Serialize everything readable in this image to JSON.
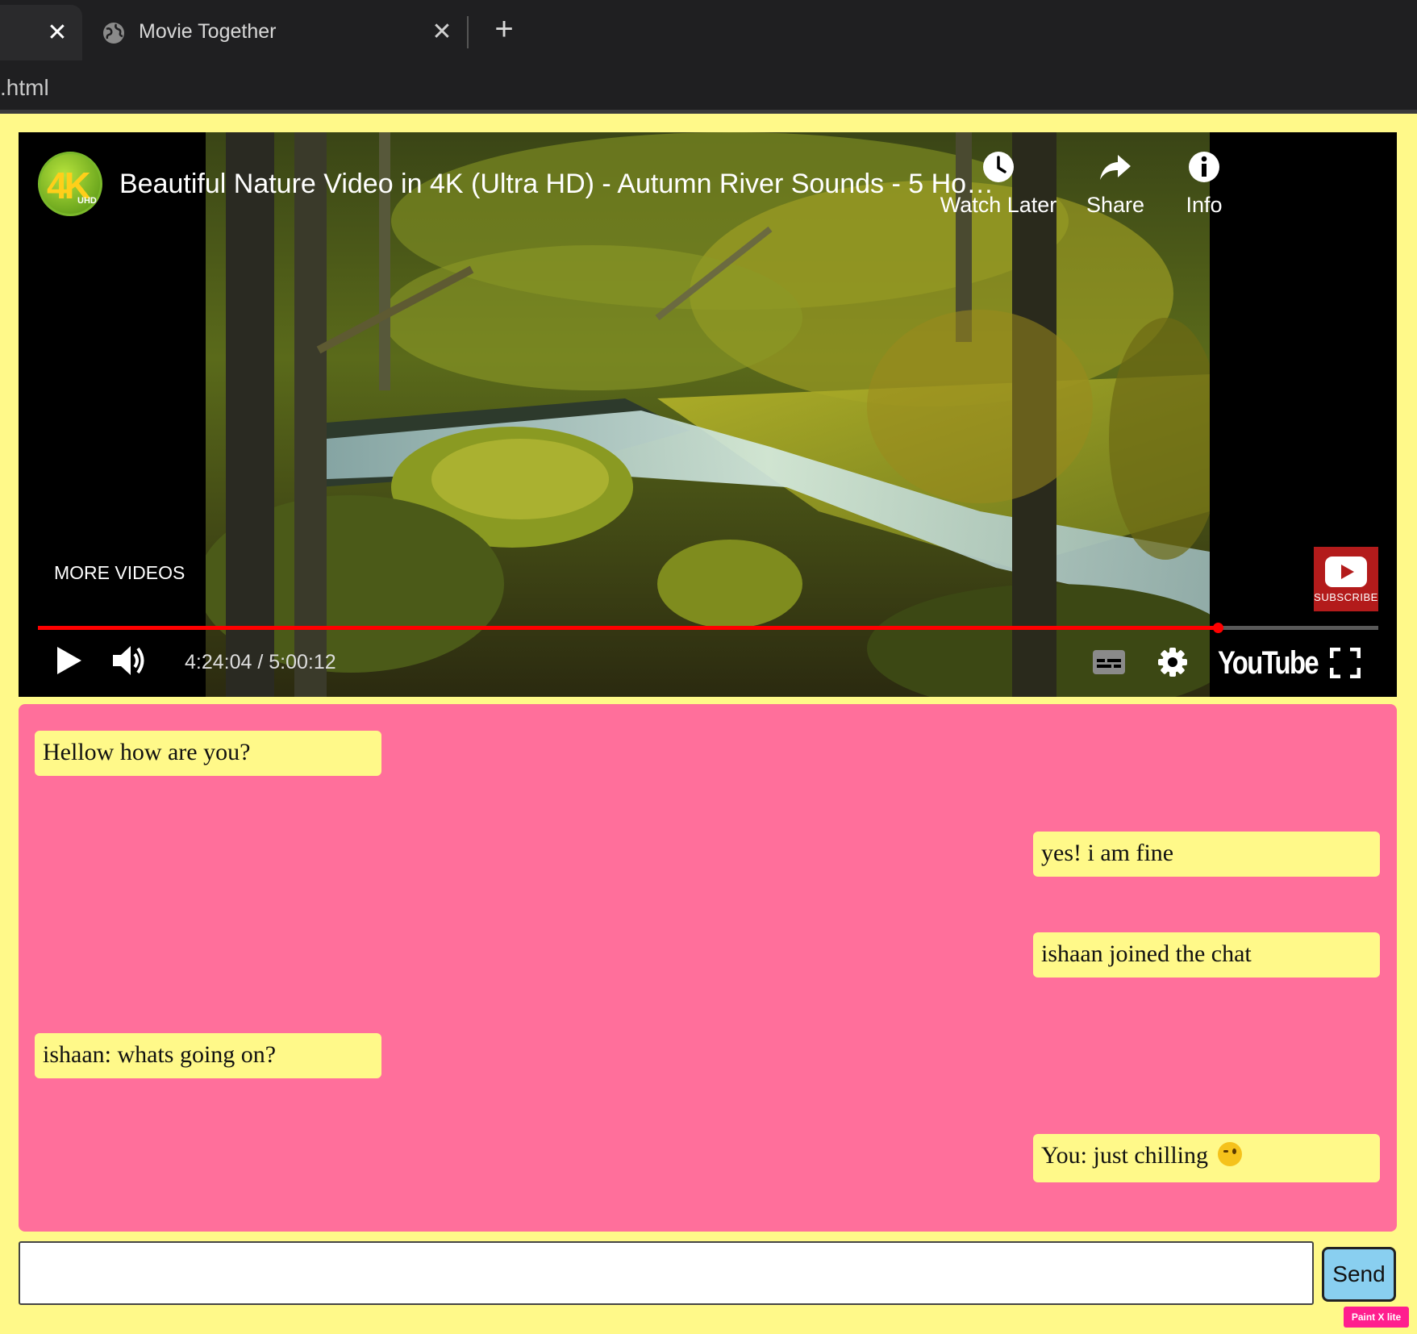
{
  "browser": {
    "active_tab_title": "Movie Together",
    "address_text": ".html"
  },
  "player": {
    "video_title": "Beautiful Nature Video in 4K (Ultra HD) - Autumn River Sounds - 5 Ho…",
    "channel_logo_text": "4K",
    "channel_logo_subtext": "UHD",
    "watch_later_label": "Watch Later",
    "share_label": "Share",
    "info_label": "Info",
    "more_videos_label": "MORE VIDEOS",
    "subscribe_label": "SUBSCRIBE",
    "current_time": "4:24:04",
    "duration": "5:00:12",
    "time_display": "4:24:04 / 5:00:12",
    "progress_fraction": 0.88,
    "youtube_label": "YouTube",
    "accent_color": "#ff0000",
    "icons": [
      "play-icon",
      "volume-icon",
      "captions-icon",
      "settings-icon",
      "fullscreen-icon",
      "clock-icon",
      "share-arrow-icon",
      "info-icon"
    ]
  },
  "chat": {
    "background_color": "#ff6f9b",
    "bubble_color": "#fff989",
    "messages": [
      {
        "text": "Hellow how are you?",
        "side": "left"
      },
      {
        "text": "yes! i am fine",
        "side": "right"
      },
      {
        "text": "ishaan joined the chat",
        "side": "right"
      },
      {
        "text": "ishaan: whats going on?",
        "side": "left"
      },
      {
        "text": "You: just chilling",
        "side": "right",
        "emoji": "winking-face"
      }
    ]
  },
  "composer": {
    "input_value": "",
    "send_label": "Send",
    "send_color": "#89cff0"
  },
  "watermark": {
    "text": "Paint X lite"
  }
}
